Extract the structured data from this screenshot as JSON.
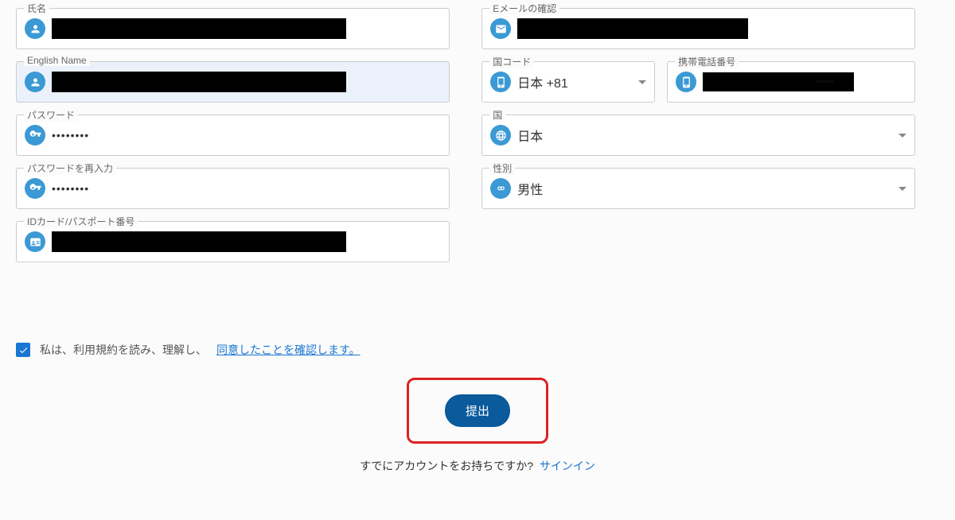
{
  "fields": {
    "name": {
      "label": "氏名"
    },
    "emailConfirm": {
      "label": "Eメールの確認"
    },
    "englishName": {
      "label": "English Name"
    },
    "countryCode": {
      "label": "国コード",
      "value": "日本 +81"
    },
    "mobile": {
      "label": "携帯電話番号"
    },
    "password": {
      "label": "パスワード",
      "value": "••••••••"
    },
    "country": {
      "label": "国",
      "value": "日本"
    },
    "passwordConfirm": {
      "label": "パスワードを再入力",
      "value": "••••••••"
    },
    "gender": {
      "label": "性別",
      "value": "男性"
    },
    "idCard": {
      "label": "IDカード/パスポート番号"
    }
  },
  "agreement": {
    "prefix": "私は、利用規約を読み、理解し、",
    "link": "同意したことを確認します。",
    "checked": true
  },
  "submit": {
    "label": "提出"
  },
  "signin": {
    "question": "すでにアカウントをお持ちですか?",
    "link": "サインイン"
  }
}
